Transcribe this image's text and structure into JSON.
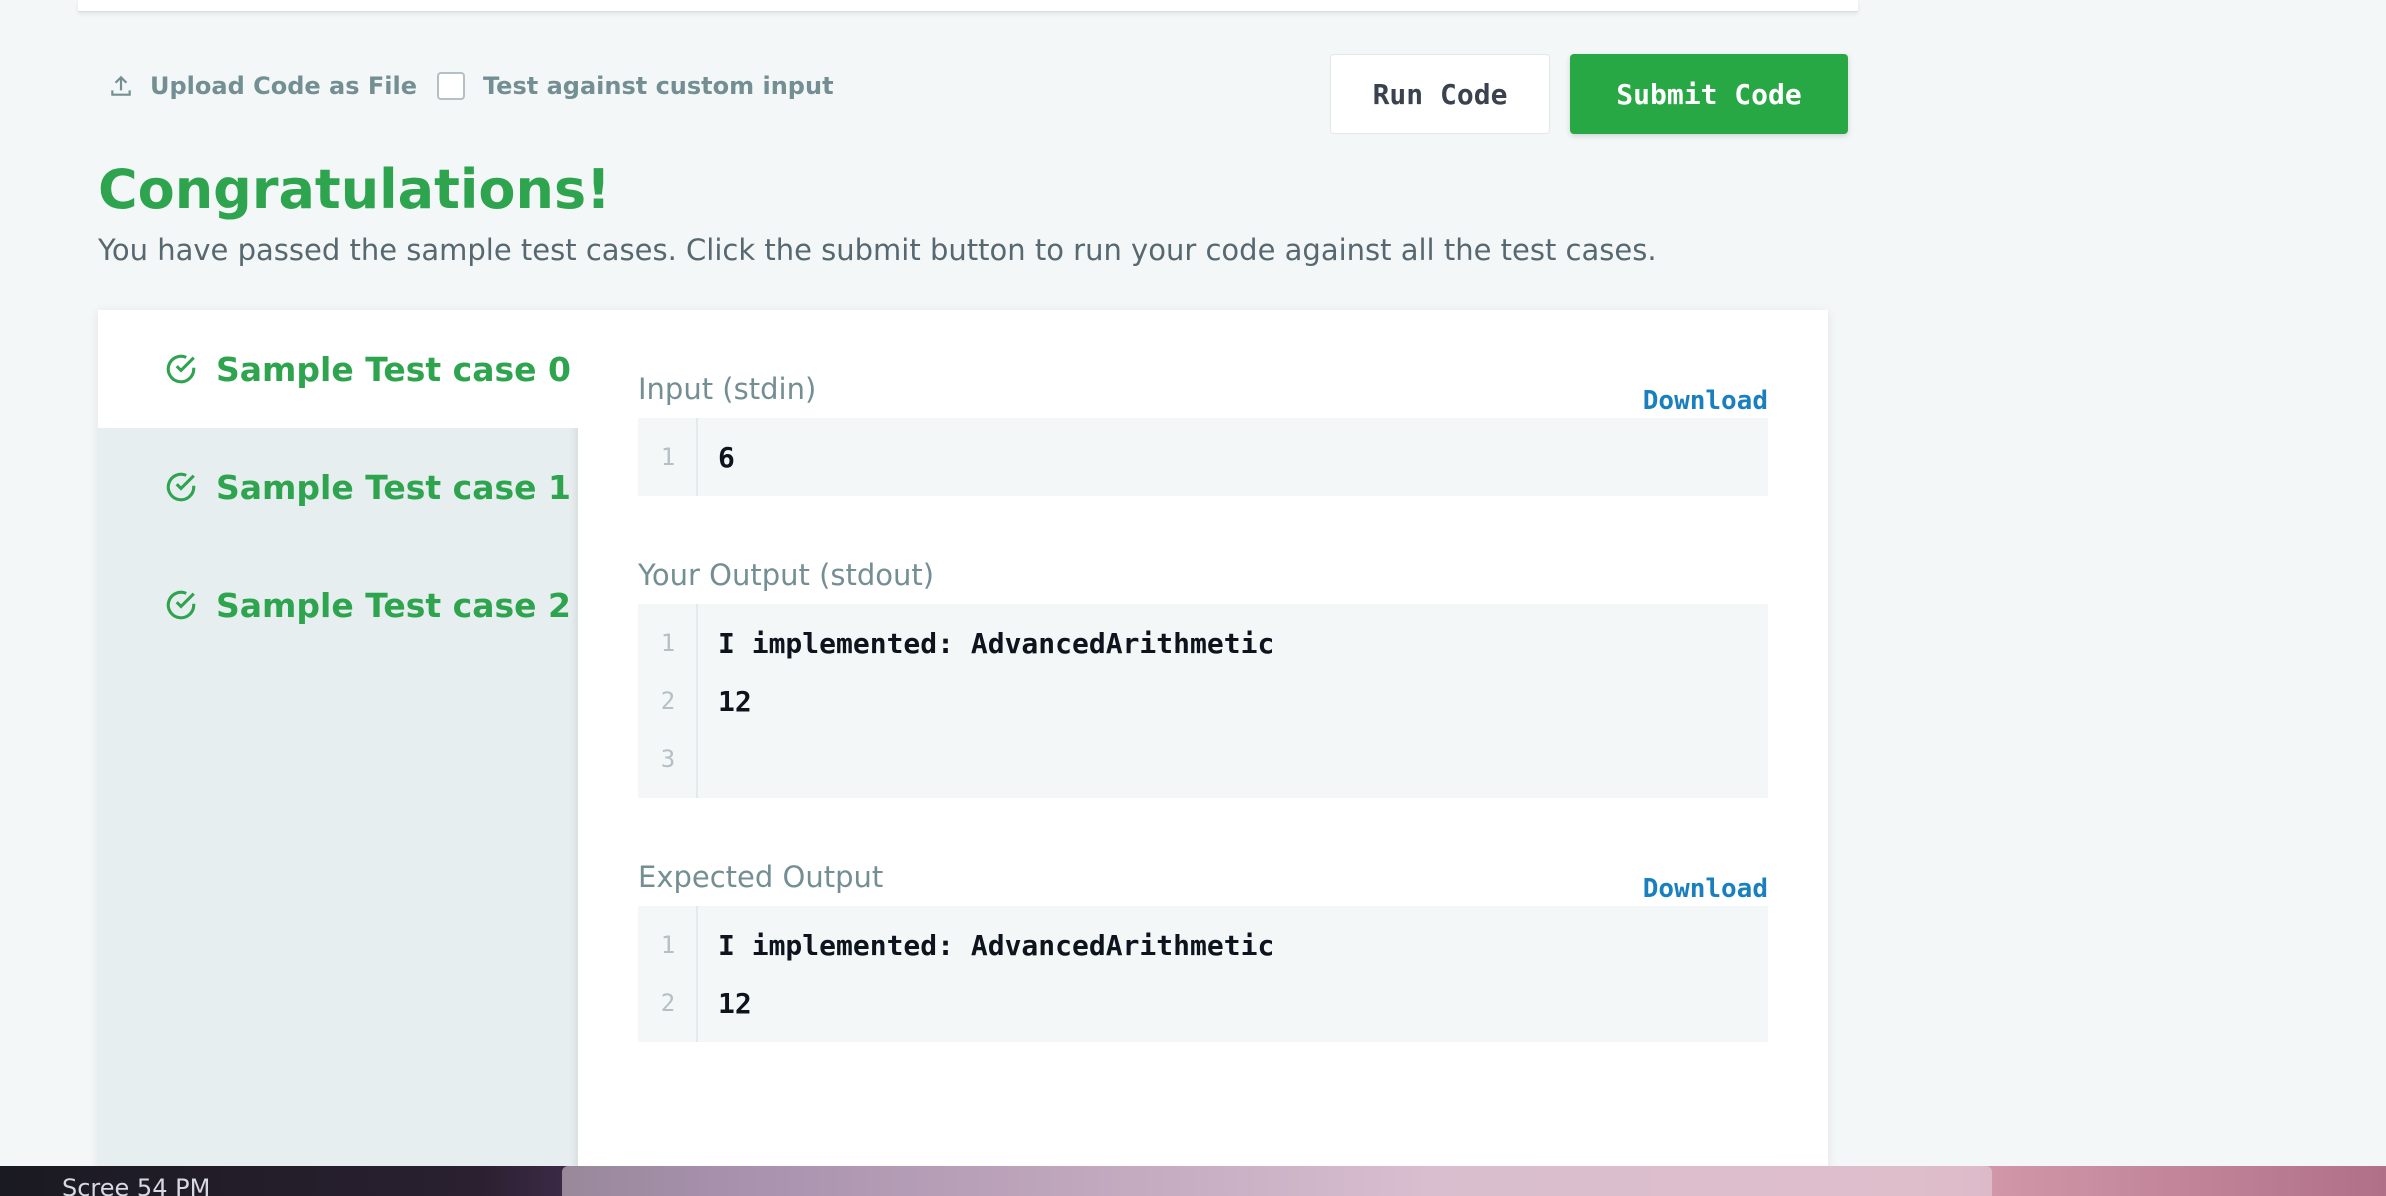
{
  "toolbar": {
    "upload_label": "Upload Code as File",
    "custom_input_label": "Test against custom input",
    "run_label": "Run Code",
    "submit_label": "Submit Code"
  },
  "result": {
    "title": "Congratulations!",
    "description": "You have passed the sample test cases. Click the submit button to run your code against all the test cases."
  },
  "test_cases": [
    {
      "label": "Sample Test case 0",
      "active": true
    },
    {
      "label": "Sample Test case 1",
      "active": false
    },
    {
      "label": "Sample Test case 2",
      "active": false
    }
  ],
  "input": {
    "label": "Input (stdin)",
    "download_label": "Download",
    "lines": [
      {
        "n": "1",
        "text": "6"
      }
    ]
  },
  "your_output": {
    "label": "Your Output (stdout)",
    "lines": [
      {
        "n": "1",
        "text": "I implemented: AdvancedArithmetic"
      },
      {
        "n": "2",
        "text": "12"
      },
      {
        "n": "3",
        "text": ""
      }
    ]
  },
  "expected_output": {
    "label": "Expected Output",
    "download_label": "Download",
    "lines": [
      {
        "n": "1",
        "text": "I implemented: AdvancedArithmetic"
      },
      {
        "n": "2",
        "text": "12"
      }
    ]
  },
  "taskbar": {
    "text": "Scree  54 PM"
  },
  "colors": {
    "success": "#2ea44f",
    "link": "#1a7fbf",
    "muted": "#738f93"
  }
}
